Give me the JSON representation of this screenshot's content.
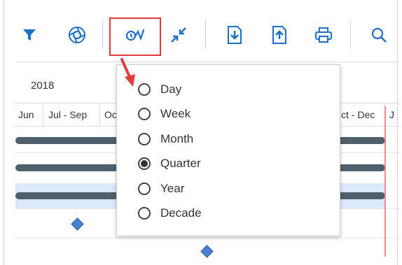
{
  "toolbar": {
    "buttons": [
      {
        "icon": "filter-icon"
      },
      {
        "icon": "aperture-icon"
      },
      {
        "icon": "timescale-icon"
      },
      {
        "icon": "collapse-arrows-icon"
      },
      {
        "icon": "import-icon"
      },
      {
        "icon": "export-icon"
      },
      {
        "icon": "printer-icon"
      },
      {
        "icon": "search-icon"
      }
    ],
    "accent_color": "#1f6fc5",
    "highlight_color": "#e23b3b"
  },
  "timeline": {
    "year": "2018",
    "periods": [
      "Jun",
      "Jul - Sep",
      "Oc",
      "ct - Dec",
      "J"
    ]
  },
  "scale_menu": {
    "options": [
      {
        "label": "Day",
        "selected": false
      },
      {
        "label": "Week",
        "selected": false
      },
      {
        "label": "Month",
        "selected": false
      },
      {
        "label": "Quarter",
        "selected": true
      },
      {
        "label": "Year",
        "selected": false
      },
      {
        "label": "Decade",
        "selected": false
      }
    ]
  }
}
